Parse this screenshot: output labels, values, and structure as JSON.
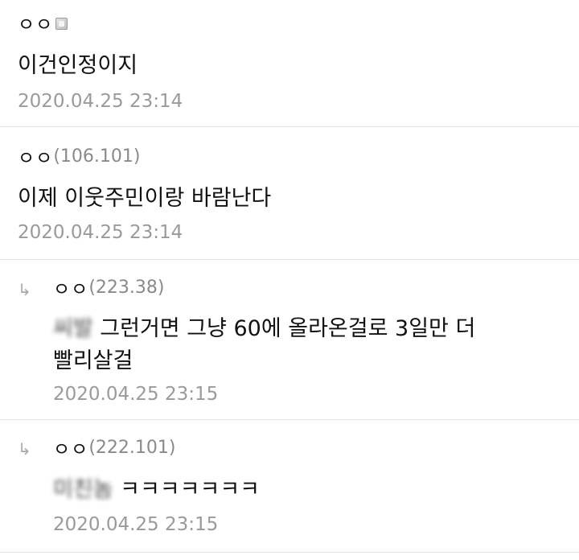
{
  "comments": [
    {
      "nick": "ㅇㅇ",
      "ip": "",
      "body_hidden": "",
      "body": "이건인정이지",
      "date": "2020.04.25 23:14"
    },
    {
      "nick": "ㅇㅇ",
      "ip": "(106.101)",
      "body_hidden": "",
      "body": "이제 이웃주민이랑 바람난다",
      "date": "2020.04.25 23:14"
    },
    {
      "nick": "ㅇㅇ",
      "ip": "(223.38)",
      "body_hidden": "씨발",
      "body": " 그런거면 그냥 60에 올라온걸로 3일만 더",
      "body_line2": "빨리살걸",
      "date": "2020.04.25 23:15"
    },
    {
      "nick": "ㅇㅇ",
      "ip": "(222.101)",
      "body_hidden": "미친놈",
      "body": " ㅋㅋㅋㅋㅋㅋㅋ",
      "date": "2020.04.25 23:15"
    }
  ],
  "icons": {
    "reply": "↳",
    "member": "member-badge-icon"
  }
}
